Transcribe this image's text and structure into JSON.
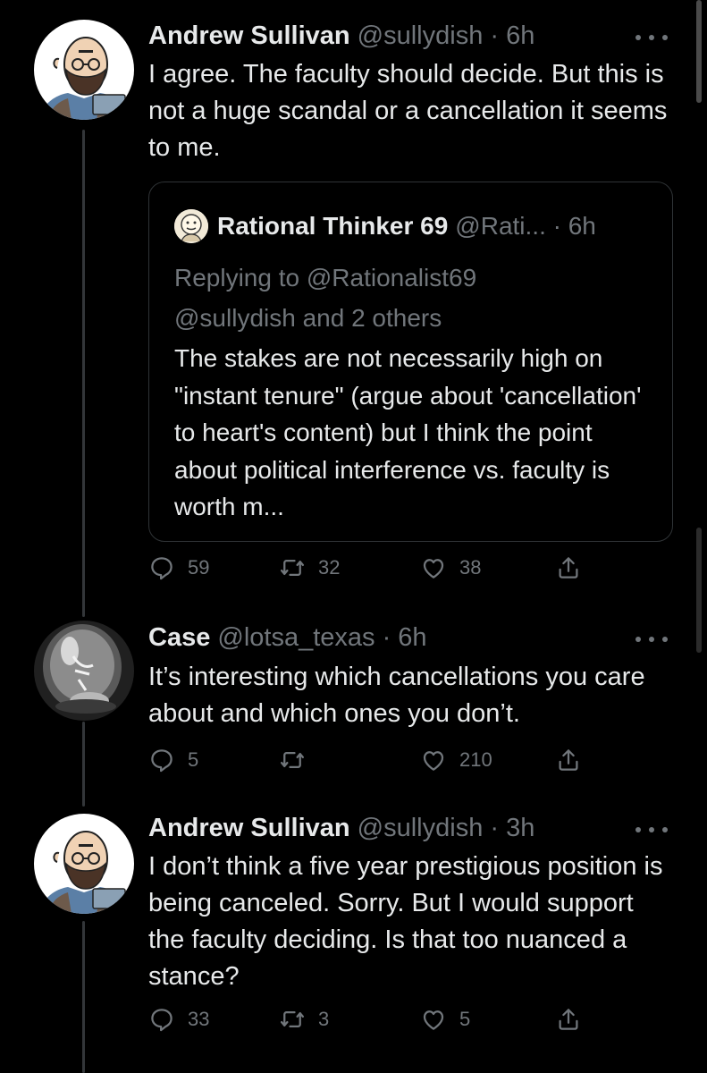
{
  "tweets": [
    {
      "name": "Andrew Sullivan",
      "meta": "@sullydish · 6h",
      "text": "I agree. The faculty should decide. But this is not a huge scandal or a cancellation it seems to me.",
      "avatar_icon": "cartoon-bald-man-avatar",
      "quote": {
        "name": "Rational Thinker 69",
        "meta": "@Rati... · 6h",
        "reply_line1": "Replying to @Rationalist69",
        "reply_line2": "@sullydish and 2 others",
        "text": "The stakes are not necessarily high on \"instant tenure\" (argue about 'cancellation' to heart's content) but I think the point about political interference vs. faculty is worth m..."
      },
      "replies": "59",
      "retweets": "32",
      "likes": "38"
    },
    {
      "name": "Case",
      "meta": "@lotsa_texas · 6h",
      "text": "It’s interesting which cancellations you care about and which ones you don’t.",
      "avatar_icon": "lightbulb-photo-avatar",
      "replies": "5",
      "retweets": "",
      "likes": "210"
    },
    {
      "name": "Andrew Sullivan",
      "meta": "@sullydish · 3h",
      "text": "I don’t think a five year prestigious position is being canceled. Sorry. But I would support the faculty deciding. Is that too nuanced a stance?",
      "avatar_icon": "cartoon-bald-man-avatar",
      "replies": "33",
      "retweets": "3",
      "likes": "5"
    }
  ],
  "icons": {
    "reply": "reply-icon",
    "retweet": "retweet-icon",
    "like": "heart-icon",
    "share": "share-icon",
    "more": "more-options-icon"
  },
  "colors": {
    "background": "#000000",
    "text": "#e7e9ea",
    "secondary": "#71767b",
    "border": "#2f3336"
  }
}
